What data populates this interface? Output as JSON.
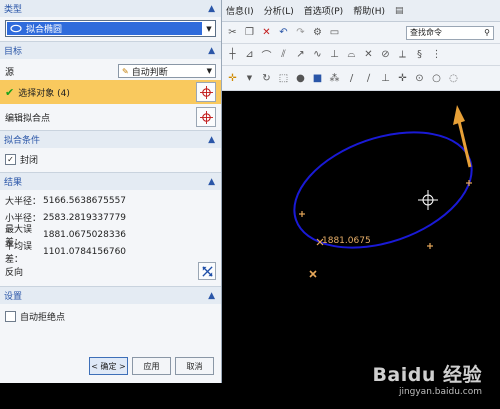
{
  "dialog": {
    "type_section": {
      "title": "类型",
      "selected": "拟合椭圆"
    },
    "target_section": {
      "title": "目标",
      "source_label": "源",
      "source_value": "自动判断",
      "select_object": "选择对象 (4)",
      "edit_fit_points": "编辑拟合点"
    },
    "fit_conditions": {
      "title": "拟合条件",
      "closed_label": "封闭",
      "closed_checked": true
    },
    "results": {
      "title": "结果",
      "rows": [
        {
          "label": "大半径：",
          "value": "5166.5638675557"
        },
        {
          "label": "小半径：",
          "value": "2583.2819337779"
        },
        {
          "label": "最大误差：",
          "value": "1881.0675028336"
        },
        {
          "label": "平均误差：",
          "value": "1101.0784156760"
        }
      ],
      "reverse_label": "反向"
    },
    "settings": {
      "title": "设置",
      "auto_reject_label": "自动拒绝点",
      "auto_reject_checked": false
    },
    "buttons": {
      "ok": "< 确定 >",
      "apply": "应用",
      "cancel": "取消"
    }
  },
  "menubar": {
    "items": [
      "信息(I)",
      "分析(L)",
      "首选项(P)",
      "帮助(H)"
    ]
  },
  "search": {
    "placeholder": "查找命令"
  },
  "viewport": {
    "error_label": "1881.0675",
    "ellipse_color": "#1a1ad6",
    "point_color": "#e7a85a",
    "arrow_color": "#e7a037"
  },
  "watermark": {
    "brand": "Baidu 经验",
    "site": "jingyan.baidu.com"
  }
}
